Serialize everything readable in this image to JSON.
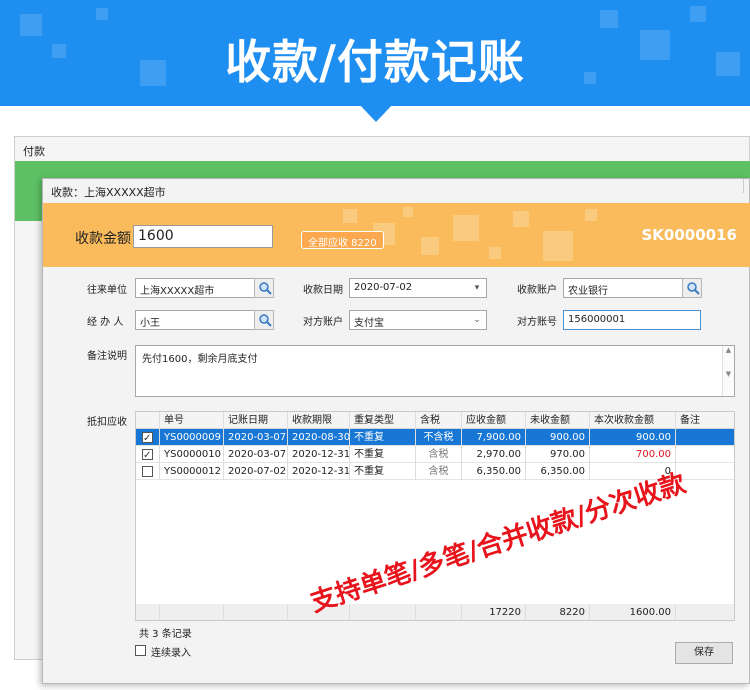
{
  "banner": {
    "title": "收款/付款记账"
  },
  "back_window": {
    "title": "付款"
  },
  "window": {
    "title": "收款：上海XXXXX超市"
  },
  "header": {
    "amount_label": "收款金额",
    "amount_value": "1600",
    "due_badge": "全部应收 8220",
    "doc_no": "SK0000016",
    "accent_color": "#f9bb5b"
  },
  "form": {
    "partner_label": "往来单位",
    "partner_value": "上海XXXXX超市",
    "date_label": "收款日期",
    "date_value": "2020-07-02",
    "account_label": "收款账户",
    "account_value": "农业银行",
    "handler_label": "经 办 人",
    "handler_value": "小王",
    "counter_account_label": "对方账户",
    "counter_account_value": "支付宝",
    "counter_no_label": "对方账号",
    "counter_no_value": "156000001",
    "memo_label": "备注说明",
    "memo_value": "先付1600，剩余月底支付",
    "offset_label": "抵扣应收"
  },
  "grid": {
    "columns": [
      "",
      "单号",
      "记账日期",
      "收款期限",
      "重复类型",
      "含税",
      "应收金额",
      "未收金额",
      "本次收款金额",
      "备注"
    ],
    "rows": [
      {
        "checked": true,
        "no": "YS0000009",
        "date": "2020-03-07",
        "due": "2020-08-30",
        "repeat": "不重复",
        "tax": "不含税",
        "amount": "7,900.00",
        "unpaid": "900.00",
        "this": "900.00",
        "note": ""
      },
      {
        "checked": true,
        "no": "YS0000010",
        "date": "2020-03-07",
        "due": "2020-12-31",
        "repeat": "不重复",
        "tax": "含税",
        "amount": "2,970.00",
        "unpaid": "970.00",
        "this": "700.00",
        "note": ""
      },
      {
        "checked": false,
        "no": "YS0000012",
        "date": "2020-07-02",
        "due": "2020-12-31",
        "repeat": "不重复",
        "tax": "含税",
        "amount": "6,350.00",
        "unpaid": "6,350.00",
        "this": "0",
        "note": ""
      }
    ],
    "totals": {
      "amount": "17220",
      "unpaid": "8220",
      "this": "1600.00"
    }
  },
  "promo_text": "支持单笔/多笔/合并收款/分次收款",
  "footer": {
    "record_count": "共 3 条记录",
    "continuous_label": "连续录入",
    "save_label": "保存"
  }
}
